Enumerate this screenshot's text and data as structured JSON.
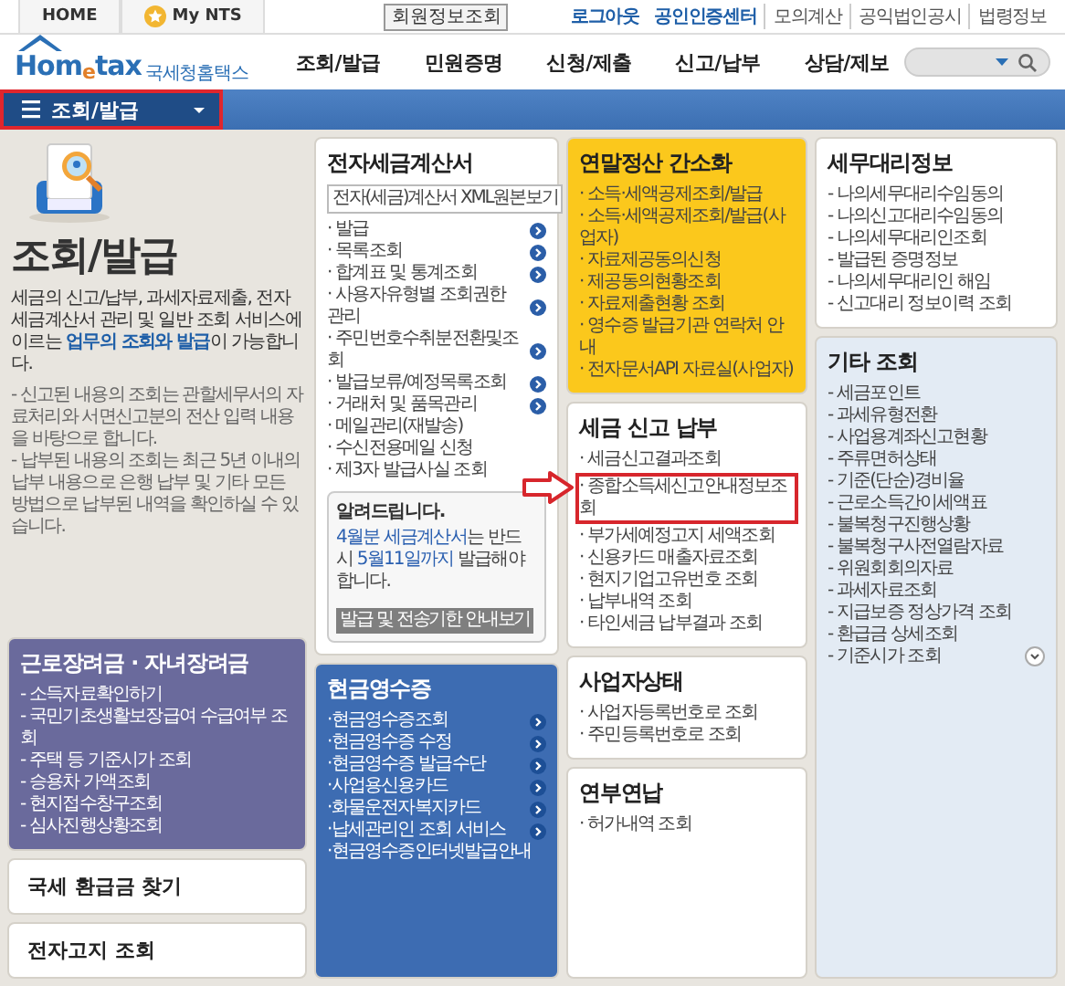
{
  "top_bar": {
    "tabs": [
      {
        "label": "HOME",
        "starred": false
      },
      {
        "label": "My NTS",
        "starred": true
      }
    ],
    "member_button": "회원정보조회",
    "links": [
      {
        "label": "로그아웃",
        "emphasized": true
      },
      {
        "label": "공인인증센터",
        "emphasized": true
      },
      {
        "label": "모의계산",
        "emphasized": false
      },
      {
        "label": "공익법인공시",
        "emphasized": false
      },
      {
        "label": "법령정보",
        "emphasized": false
      }
    ]
  },
  "header": {
    "logo": {
      "wordmark": "Hom$_{e}$tax",
      "name": "국세청홈택스"
    },
    "nav": [
      {
        "label": "조회/발급",
        "selected": false
      },
      {
        "label": "민원증명",
        "selected": false
      },
      {
        "label": "신청/제출",
        "selected": false
      },
      {
        "label": "신고/납부",
        "selected": false
      },
      {
        "label": "상담/제보",
        "selected": false
      }
    ]
  },
  "breadcrumb": {
    "label": "조회/발급",
    "highlighted": true
  },
  "columns": [
    {
      "intro": {
        "title": "조회/발급",
        "description": "세금의 신고/납부, 과세자료제출, 전자세금계산서 관리 및 일반 조회 서비스에 이르는 **업무의 조회와 발급**이 가능합니다.",
        "notes": [
          "- 신고된 내용의 조회는 관할세무서의 자료처리와 서면신고분의 전산 입력 내용을 바탕으로 합니다.",
          "- 납부된 내용의 조회는 최근 5년 이내의 납부 내용으로 은행 납부 및 기타 모든 방법으로 납부된 내역을 확인하실 수 있습니다."
        ]
      },
      "cards": [
        {
          "kind": "list",
          "title": "근로장려금 · 자녀장려금",
          "color": "#6a6a9c",
          "items": [
            {
              "label": "- 소득자료확인하기"
            },
            {
              "label": "- 국민기초생활보장급여 수급여부 조회"
            },
            {
              "label": "- 주택 등 기준시가 조회"
            },
            {
              "label": "- 승용차 가액조회"
            },
            {
              "label": "- 현지접수창구조회"
            },
            {
              "label": "- 심사진행상황조회"
            }
          ]
        },
        {
          "kind": "link",
          "title": "국세 환급금 찾기",
          "color": "#ffffff"
        },
        {
          "kind": "link",
          "title": "전자고지 조회",
          "color": "#ffffff"
        }
      ]
    },
    {
      "cards": [
        {
          "kind": "list",
          "title": "전자세금계산서",
          "color": "#ffffff",
          "button": "전자(세금)계산서 XML원본보기",
          "items": [
            {
              "label": "· 발급",
              "has_icon": true
            },
            {
              "label": "· 목록조회",
              "has_icon": true
            },
            {
              "label": "· 합계표 및 통계조회",
              "has_icon": true
            },
            {
              "label": "· 사용자유형별 조회권한 관리",
              "has_icon": true
            },
            {
              "label": "· 주민번호수취분전환및조회",
              "has_icon": true
            },
            {
              "label": "· 발급보류/예정목록조회",
              "has_icon": true
            },
            {
              "label": "· 거래처 및 품목관리",
              "has_icon": true
            },
            {
              "label": "· 메일관리(재발송)",
              "has_icon": false
            },
            {
              "label": "· 수신전용메일 신청",
              "has_icon": false
            },
            {
              "label": "· 제3자 발급사실 조회",
              "has_icon": false
            }
          ],
          "notice": {
            "title": "알려드립니다.",
            "text": "**4월분 세금계산서**는 반드시 **5월11일까지** 발급해야 합니다.",
            "button": "발급 및 전송기한 안내보기"
          }
        },
        {
          "kind": "list",
          "title": "현금영수증",
          "color": "#3d6cb2",
          "items": [
            {
              "label": "·현금영수증조회",
              "has_icon": true
            },
            {
              "label": "·현금영수증 수정",
              "has_icon": true
            },
            {
              "label": "·현금영수증 발급수단",
              "has_icon": true
            },
            {
              "label": "·사업용신용카드",
              "has_icon": true
            },
            {
              "label": "·화물운전자복지카드",
              "has_icon": true
            },
            {
              "label": "·납세관리인 조회 서비스",
              "has_icon": true
            },
            {
              "label": "·현금영수증인터넷발급안내",
              "has_icon": false
            }
          ]
        }
      ]
    },
    {
      "cards": [
        {
          "kind": "list",
          "title": "연말정산 간소화",
          "color": "#fbc81c",
          "items": [
            {
              "label": "· 소득·세액공제조회/발급"
            },
            {
              "label": "· 소득·세액공제조회/발급(사업자)"
            },
            {
              "label": "· 자료제공동의신청"
            },
            {
              "label": "· 제공동의현황조회"
            },
            {
              "label": "· 자료제출현황 조회"
            },
            {
              "label": "· 영수증 발급기관 연락처 안내"
            },
            {
              "label": "· 전자문서API 자료실(사업자)"
            }
          ]
        },
        {
          "kind": "list",
          "title": "세금 신고 납부",
          "color": "#ffffff",
          "items": [
            {
              "label": "· 세금신고결과조회",
              "highlighted": false
            },
            {
              "label": "· 종합소득세신고안내정보조회",
              "highlighted": true
            },
            {
              "label": "· 부가세예정고지 세액조회",
              "highlighted": false
            },
            {
              "label": "· 신용카드 매출자료조회",
              "highlighted": false
            },
            {
              "label": "· 현지기업고유번호 조회",
              "highlighted": false
            },
            {
              "label": "· 납부내역 조회",
              "highlighted": false
            },
            {
              "label": "· 타인세금 납부결과 조회",
              "highlighted": false
            }
          ]
        },
        {
          "kind": "list",
          "title": "사업자상태",
          "color": "#ffffff",
          "items": [
            {
              "label": "· 사업자등록번호로 조회"
            },
            {
              "label": "· 주민등록번호로 조회"
            }
          ]
        },
        {
          "kind": "list",
          "title": "연부연납",
          "color": "#ffffff",
          "items": [
            {
              "label": "· 허가내역 조회"
            }
          ]
        }
      ]
    },
    {
      "cards": [
        {
          "kind": "list",
          "title": "세무대리정보",
          "color": "#ffffff",
          "items": [
            {
              "label": "- 나의세무대리수임동의"
            },
            {
              "label": "- 나의신고대리수임동의"
            },
            {
              "label": "- 나의세무대리인조회"
            },
            {
              "label": "- 발급된 증명정보"
            },
            {
              "label": "- 나의세무대리인 해임"
            },
            {
              "label": "- 신고대리 정보이력 조회"
            }
          ]
        },
        {
          "kind": "list",
          "title": "기타 조회",
          "color": "#e3ebf4",
          "more": true,
          "items": [
            {
              "label": "- 세금포인트"
            },
            {
              "label": "- 과세유형전환"
            },
            {
              "label": "- 사업용계좌신고현황"
            },
            {
              "label": "- 주류면허상태"
            },
            {
              "label": "- 기준(단순)경비율"
            },
            {
              "label": "- 근로소득간이세액표"
            },
            {
              "label": "- 불복청구진행상황"
            },
            {
              "label": "- 불복청구사전열람자료"
            },
            {
              "label": "- 위원회회의자료"
            },
            {
              "label": "- 과세자료조회"
            },
            {
              "label": "- 지급보증 정상가격 조회"
            },
            {
              "label": "- 환급금 상세조회"
            },
            {
              "label": "- 기준시가 조회"
            }
          ]
        }
      ]
    }
  ]
}
